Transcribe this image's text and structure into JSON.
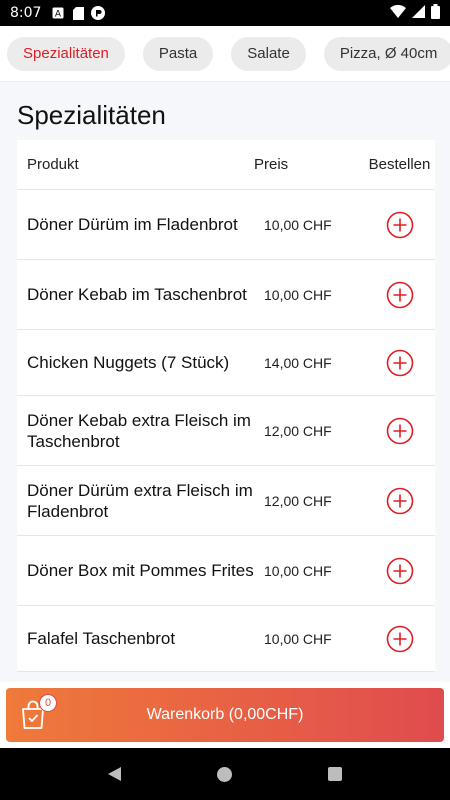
{
  "status": {
    "time": "8:07"
  },
  "categories": [
    {
      "label": "Spezialitäten",
      "active": true
    },
    {
      "label": "Pasta",
      "active": false
    },
    {
      "label": "Salate",
      "active": false
    },
    {
      "label": "Pizza, Ø 40cm",
      "active": false
    }
  ],
  "section": {
    "title": "Spezialitäten"
  },
  "table": {
    "headers": {
      "product": "Produkt",
      "price": "Preis",
      "order": "Bestellen"
    },
    "rows": [
      {
        "name": "Döner Dürüm im Fladenbrot",
        "price": "10,00 CHF"
      },
      {
        "name": "Döner Kebab im Taschenbrot",
        "price": "10,00 CHF"
      },
      {
        "name": "Chicken Nuggets (7 Stück)",
        "price": "14,00 CHF"
      },
      {
        "name": "Döner Kebab extra Fleisch im Taschenbrot",
        "price": "12,00 CHF"
      },
      {
        "name": "Döner Dürüm extra Fleisch im Fladenbrot",
        "price": "12,00 CHF"
      },
      {
        "name": "Döner Box mit Pommes Frites",
        "price": "10,00 CHF"
      },
      {
        "name": "Falafel Taschenbrot",
        "price": "10,00 CHF"
      }
    ]
  },
  "cart": {
    "label": "Warenkorb (0,00CHF)",
    "count": "0"
  },
  "colors": {
    "accent": "#e01e25",
    "cart_gradient_start": "#ef7a3a",
    "cart_gradient_end": "#e04b4e"
  }
}
